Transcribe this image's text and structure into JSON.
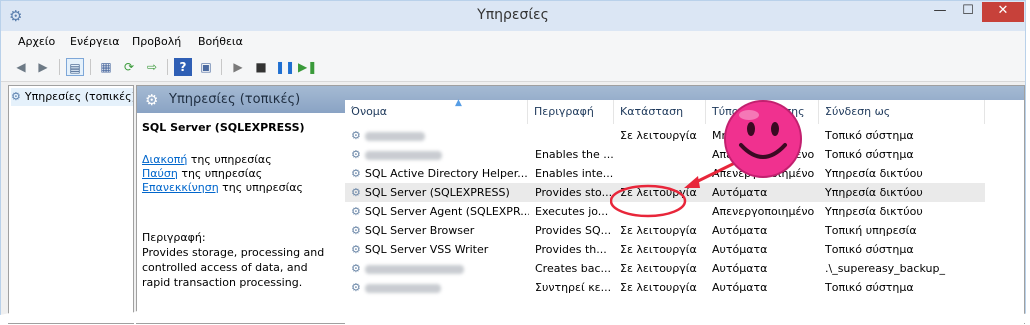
{
  "window": {
    "title": "Υπηρεσίες",
    "minimize": "—",
    "maximize": "☐",
    "close": "✕"
  },
  "menu": [
    "Αρχείο",
    "Ενέργεια",
    "Προβολή",
    "Βοήθεια"
  ],
  "toolbar": [
    "back-icon",
    "forward-icon",
    "show-hide-console-tree-icon",
    "properties-icon",
    "refresh-icon",
    "export-icon",
    "help-icon",
    "show-action-pane-icon",
    "start-service-icon",
    "stop-service-icon",
    "pause-service-icon",
    "restart-service-icon"
  ],
  "tree": {
    "item": "Υπηρεσίες (τοπικές)"
  },
  "main": {
    "title": "Υπηρεσίες (τοπικές)"
  },
  "extended": {
    "service_name": "SQL Server (SQLEXPRESS)",
    "stop_link": "Διακοπή",
    "stop_suffix": " της υπηρεσίας",
    "pause_link": "Παύση",
    "pause_suffix": " της υπηρεσίας",
    "restart_link": "Επανεκκίνηση",
    "restart_suffix": " της υπηρεσίας",
    "desc_label": "Περιγραφή:",
    "desc_text": "Provides storage, processing and controlled access of data, and rapid transaction processing."
  },
  "columns": [
    "Όνομα",
    "Περιγραφή",
    "Κατάσταση",
    "Τύπος εκκίνησης",
    "Σύνδεση ως"
  ],
  "rows": [
    {
      "name": "",
      "blur": true,
      "desc": "",
      "status": "Σε λειτουργία",
      "startup": "Μη αυτόματα",
      "logon": "Τοπικό σύστημα"
    },
    {
      "name": "",
      "blur": true,
      "desc": "Enables the ...",
      "status": "",
      "startup": "Απενεργοποιημένο",
      "logon": "Τοπικό σύστημα"
    },
    {
      "name": "SQL Active Directory Helper...",
      "blur": false,
      "desc": "Enables inte...",
      "status": "",
      "startup": "Απενεργοποιημένο",
      "logon": "Υπηρεσία δικτύου"
    },
    {
      "name": "SQL Server (SQLEXPRESS)",
      "blur": false,
      "desc": "Provides sto...",
      "status": "Σε λειτουργία",
      "startup": "Αυτόματα",
      "logon": "Υπηρεσία δικτύου"
    },
    {
      "name": "SQL Server Agent (SQLEXPR...",
      "blur": false,
      "desc": "Executes jo...",
      "status": "",
      "startup": "Απενεργοποιημένο",
      "logon": "Υπηρεσία δικτύου"
    },
    {
      "name": "SQL Server Browser",
      "blur": false,
      "desc": "Provides SQ...",
      "status": "Σε λειτουργία",
      "startup": "Αυτόματα",
      "logon": "Τοπική υπηρεσία"
    },
    {
      "name": "SQL Server VSS Writer",
      "blur": false,
      "desc": "Provides th...",
      "status": "Σε λειτουργία",
      "startup": "Αυτόματα",
      "logon": "Τοπικό σύστημα"
    },
    {
      "name": "",
      "blur": true,
      "desc": "Creates bac...",
      "status": "Σε λειτουργία",
      "startup": "Αυτόματα",
      "logon": ".\\_supereasy_backup_"
    },
    {
      "name": "",
      "blur": true,
      "desc": "Συντηρεί κε...",
      "status": "Σε λειτουργία",
      "startup": "Αυτόματα",
      "logon": "Τοπικό σύστημα"
    }
  ],
  "colors": {
    "accent_red": "#e8263a",
    "smiley_pink": "#f0318f",
    "header_blue": "#8aa3c4"
  }
}
